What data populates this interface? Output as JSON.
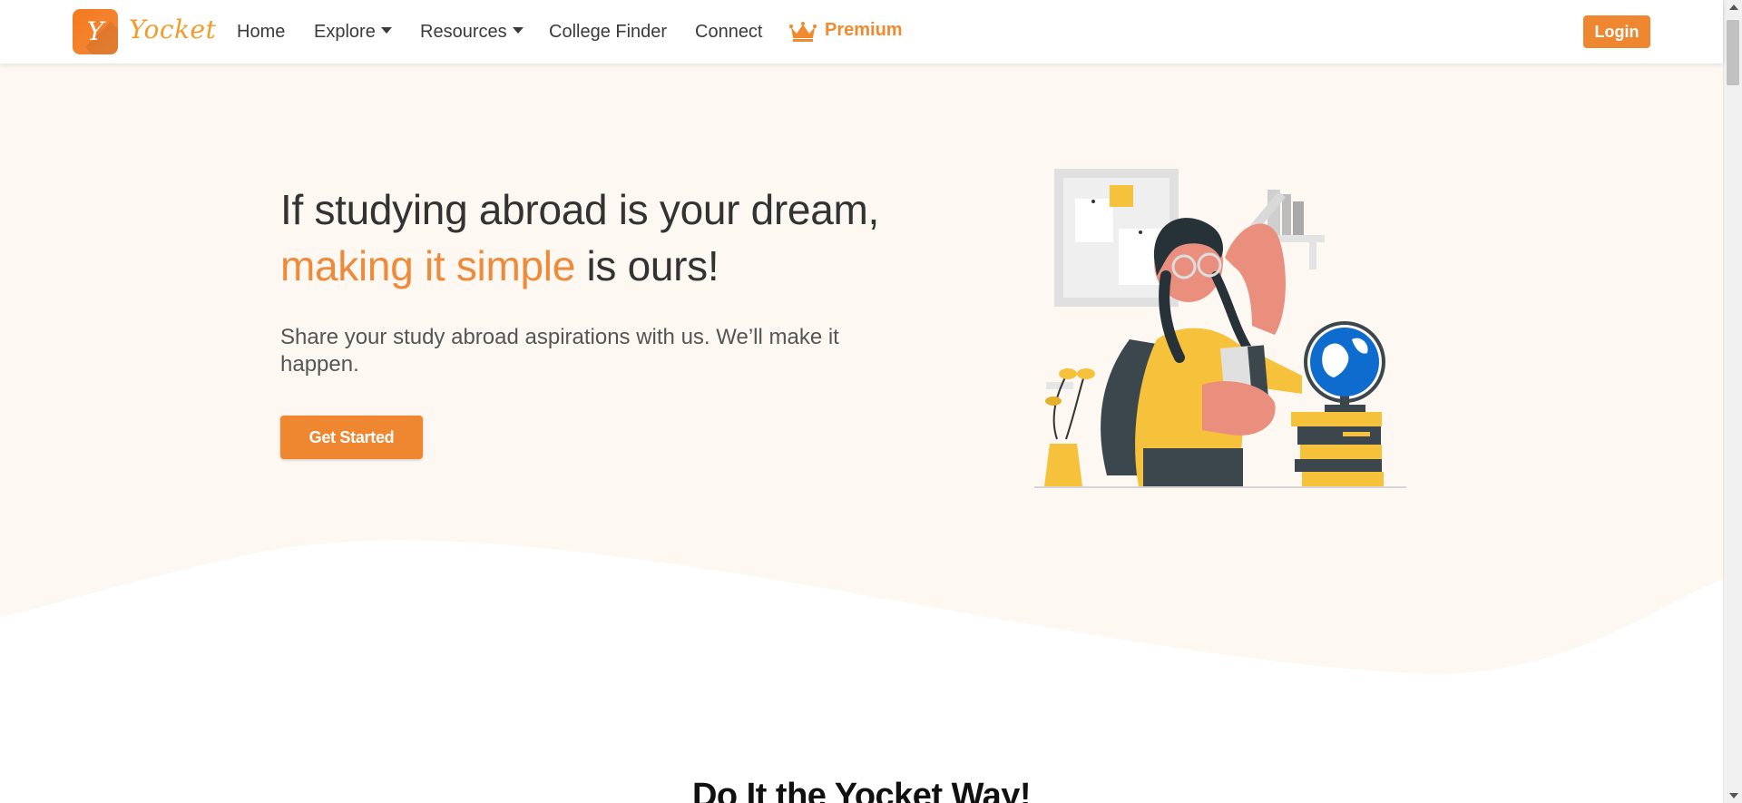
{
  "nav": {
    "logo_letter": "Y",
    "logo_word": "Yocket",
    "items": [
      {
        "label": "Home"
      },
      {
        "label": "Explore",
        "has_dropdown": true
      },
      {
        "label": "Resources",
        "has_dropdown": true
      },
      {
        "label": "College Finder"
      },
      {
        "label": "Connect"
      }
    ],
    "premium_label": "Premium",
    "premium_icon": "crown-icon",
    "login_label": "Login"
  },
  "hero": {
    "headline_line1": "If studying abroad is your dream,",
    "headline_accent": "making it simple",
    "headline_rest": " is ours!",
    "subtext": "Share your study abroad aspirations with us. We’ll make it happen.",
    "cta_label": "Get Started",
    "illustration": "student-with-globe-illustration"
  },
  "section": {
    "title": "Do It the Yocket Way!"
  },
  "colors": {
    "brand_orange": "#ef8630",
    "accent_text": "#ef8a3a",
    "hero_bg": "#fef8f2",
    "illustration_yellow": "#f6c23b"
  }
}
